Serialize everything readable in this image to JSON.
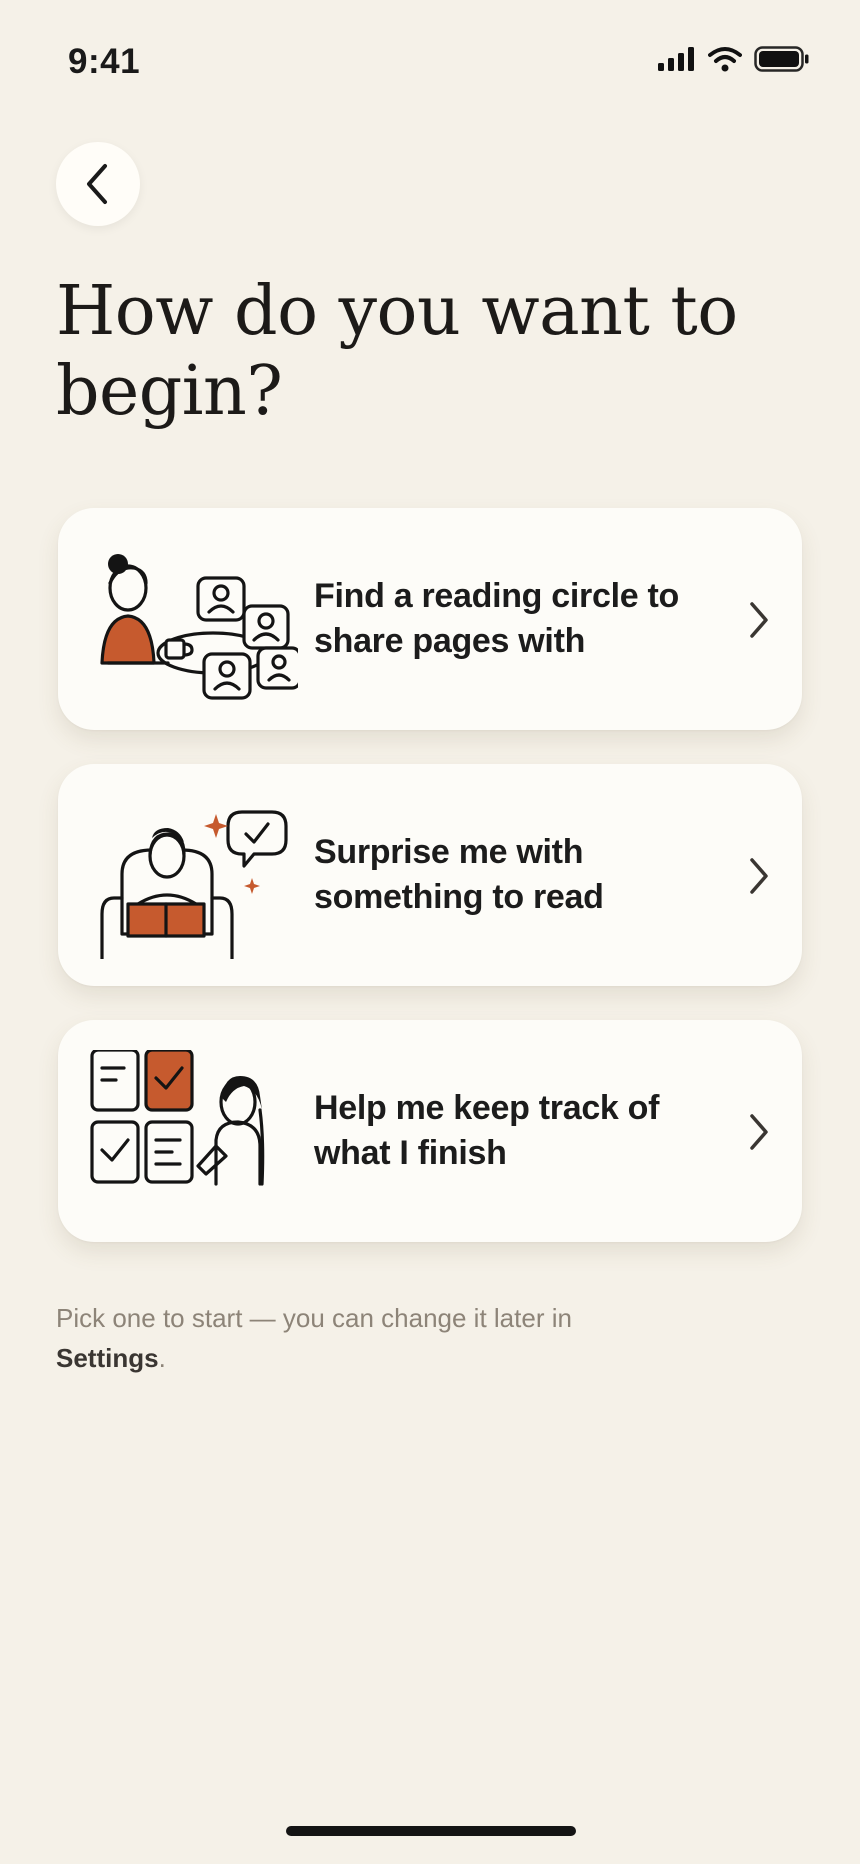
{
  "status_bar": {
    "time": "9:41",
    "icons": [
      "cellular-signal-icon",
      "wifi-icon",
      "battery-icon"
    ]
  },
  "header": {
    "back_icon": "chevron-left-icon",
    "title": "How do you want to begin?"
  },
  "options": [
    {
      "label": "Find a reading circle to share pages with",
      "illustration": "reading-circle-illustration",
      "chevron": "chevron-right-icon"
    },
    {
      "label": "Surprise me with something to read",
      "illustration": "armchair-reader-illustration",
      "chevron": "chevron-right-icon"
    },
    {
      "label": "Help me keep track of what I finish",
      "illustration": "checklist-tracker-illustration",
      "chevron": "chevron-right-icon"
    }
  ],
  "helper": {
    "prefix": "Pick one to start — you can change it later in",
    "link": "Settings",
    "suffix": "."
  },
  "colors": {
    "background": "#f5f1e8",
    "card": "#fdfcf8",
    "accent": "#c65a2e",
    "text": "#1a1a1a",
    "muted": "#8d8478"
  }
}
